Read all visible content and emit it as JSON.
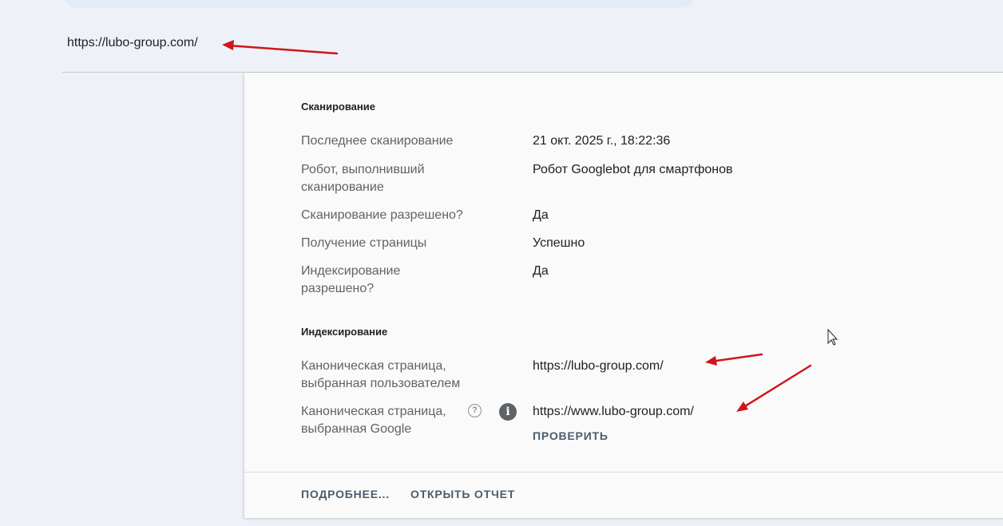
{
  "header": {
    "url": "https://lubo-group.com/"
  },
  "crawl": {
    "title": "Сканирование",
    "rows": [
      {
        "label": "Последнее сканирование",
        "value": "21 окт. 2025 г., 18:22:36"
      },
      {
        "label": "Робот, выполнивший сканирование",
        "value": "Робот Googlebot для смартфонов"
      },
      {
        "label": "Сканирование разрешено?",
        "value": "Да"
      },
      {
        "label": "Получение страницы",
        "value": "Успешно"
      },
      {
        "label": "Индексирование разрешено?",
        "value": "Да"
      }
    ]
  },
  "indexing": {
    "title": "Индексирование",
    "rows": [
      {
        "label": "Каноническая страница, выбранная пользователем",
        "value": "https://lubo-group.com/"
      },
      {
        "label": "Каноническая страница, выбранная Google",
        "value": "https://www.lubo-group.com/"
      }
    ],
    "inspect_label": "ПРОВЕРИТЬ",
    "help_glyph": "?",
    "info_glyph": "i"
  },
  "footer": {
    "learn_more_label": "ПОДРОБНЕЕ...",
    "open_report_label": "ОТКРЫТЬ ОТЧЕТ"
  },
  "colors": {
    "annotation_arrow": "#d0161b"
  },
  "icons": {
    "help": "help-circle-icon",
    "info": "info-icon",
    "cursor": "mouse-cursor-icon"
  }
}
